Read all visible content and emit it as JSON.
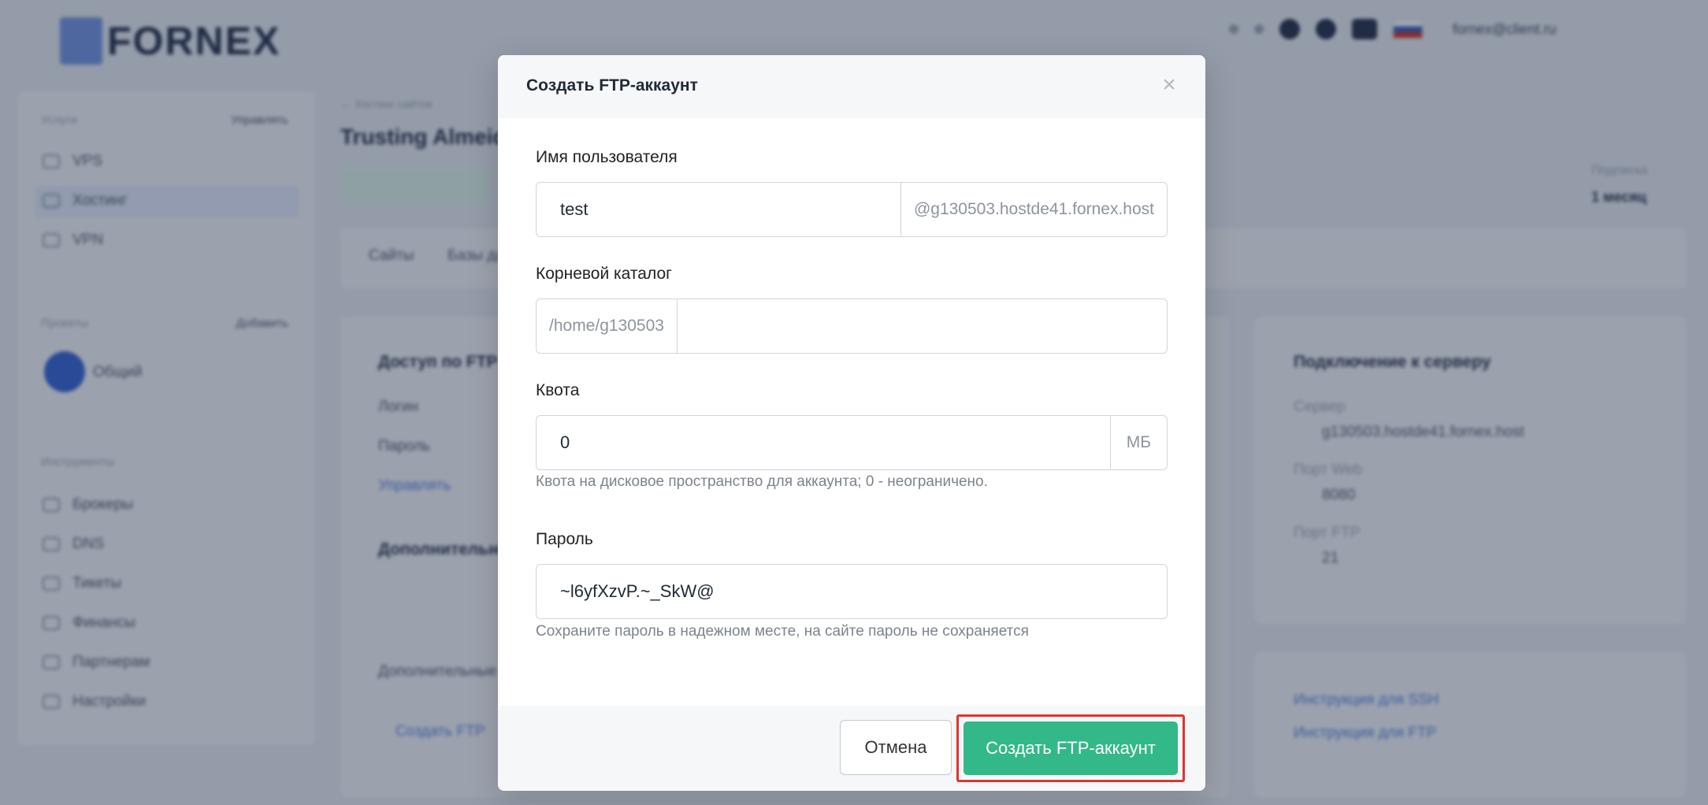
{
  "background": {
    "logo_text": "FORNEX",
    "user_email": "fornex@client.ru",
    "breadcrumb": "← Хостинг сайтов",
    "page_title": "Trusting Almeida",
    "sidebar": {
      "section_services": "Услуги",
      "add_link_1": "Управлять",
      "items_top": [
        "VPS",
        "Хостинг",
        "VPN"
      ],
      "section_projects": "Проекты",
      "add_link_2": "Добавить",
      "project_name": "Общий",
      "section_tools": "Инструменты",
      "items_bottom": [
        "Брокеры",
        "DNS",
        "Тикеты",
        "Финансы",
        "Партнерам",
        "Настройки"
      ]
    },
    "tabs": [
      "Сайты",
      "Базы данных"
    ],
    "ftp_card": {
      "title": "Доступ по FTP",
      "login_label": "Логин",
      "password_label": "Пароль",
      "manage_link": "Управлять",
      "extra_title": "Дополнительно",
      "extra_text": "Дополнительные FTP-аккаунты",
      "create_link": "Создать FTP"
    },
    "server_card": {
      "title": "Подключение к серверу",
      "server_label": "Сервер",
      "server_value": "g130503.hostde41.fornex.host",
      "port_web_label": "Порт Web",
      "port_web_value": "8080",
      "port_ftp_label": "Порт FTP",
      "port_ftp_value": "21",
      "side_label": "Подписка",
      "side_value": "1 месяц"
    },
    "links": [
      "Инструкция для SSH",
      "Инструкция для FTP"
    ]
  },
  "modal": {
    "title": "Создать FTP-аккаунт",
    "close_glyph": "×",
    "username": {
      "label": "Имя пользователя",
      "value": "test",
      "suffix": "@g130503.hostde41.fornex.host"
    },
    "root_dir": {
      "label": "Корневой каталог",
      "prefix": "/home/g130503",
      "value": ""
    },
    "quota": {
      "label": "Квота",
      "value": "0",
      "unit": "МБ",
      "help": "Квота на дисковое пространство для аккаунта; 0 - неограничено."
    },
    "password": {
      "label": "Пароль",
      "value": "~l6yfXzvP.~_SkW@",
      "help": "Сохраните пароль в надежном месте, на сайте пароль не сохраняется"
    },
    "cancel_label": "Отмена",
    "submit_label": "Создать FTP-аккаунт"
  },
  "colors": {
    "primary": "#33b889",
    "highlight": "#e0342f",
    "overlay": "#212d44"
  }
}
